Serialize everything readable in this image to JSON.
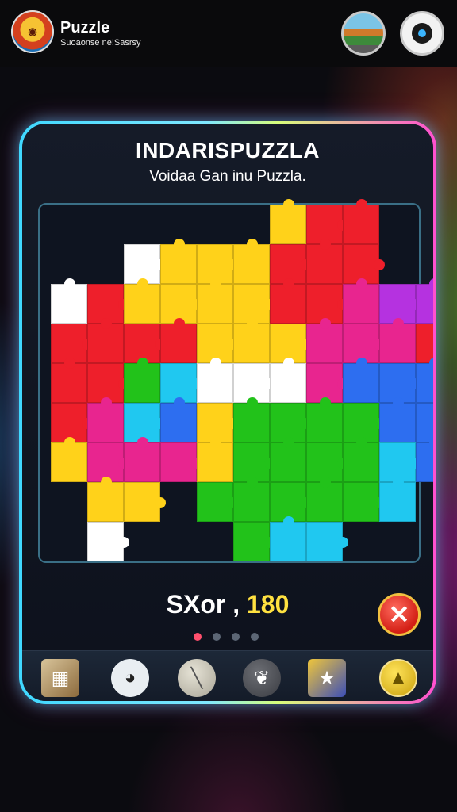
{
  "header": {
    "logo_icon": "game-logo-icon",
    "title": "Puzzle",
    "subtitle": "Suoaonse ne!Sasrsy",
    "scene_button_icon": "scene-thumbnail-icon",
    "eye_button_icon": "eye-icon"
  },
  "card": {
    "title": "INDARISPUZZLA",
    "subtitle": "Voidaa Gan inu Puzzla."
  },
  "score": {
    "label": "SXor ,",
    "value": "180"
  },
  "close_icon": "close-icon",
  "close_glyph": "✕",
  "pagination": {
    "count": 4,
    "active_index": 0
  },
  "toolbar": {
    "items": [
      {
        "icon": "landscape-card-icon",
        "glyph": "▦"
      },
      {
        "icon": "panda-icon",
        "glyph": "◕"
      },
      {
        "icon": "brush-icon",
        "glyph": "╲"
      },
      {
        "icon": "bird-icon",
        "glyph": "❦"
      },
      {
        "icon": "star-card-icon",
        "glyph": "★"
      },
      {
        "icon": "coin-icon",
        "glyph": "▲"
      }
    ]
  },
  "colors": {
    "neon_left": "#3fd8ff",
    "neon_right": "#ff4fd0",
    "score_value": "#ffe140",
    "close_red": "#d31f15"
  },
  "puzzle": {
    "rows": [
      "......yrr..",
      "..wyyyrrr..",
      "wryyyyrrmpp",
      "rrrryyymmmr",
      "rrgcwwwmbbb",
      "rmcbyggggbb",
      "ymmmyggggcb",
      ".yy.gggggc.",
      ".w...gcc..."
    ],
    "palette": {
      "y": "#ffd21a",
      "r": "#ee1f2b",
      "w": "#ffffff",
      "m": "#e8258f",
      "p": "#b532e0",
      "g": "#22c21a",
      "c": "#20c8f0",
      "b": "#2d6ef0"
    }
  }
}
